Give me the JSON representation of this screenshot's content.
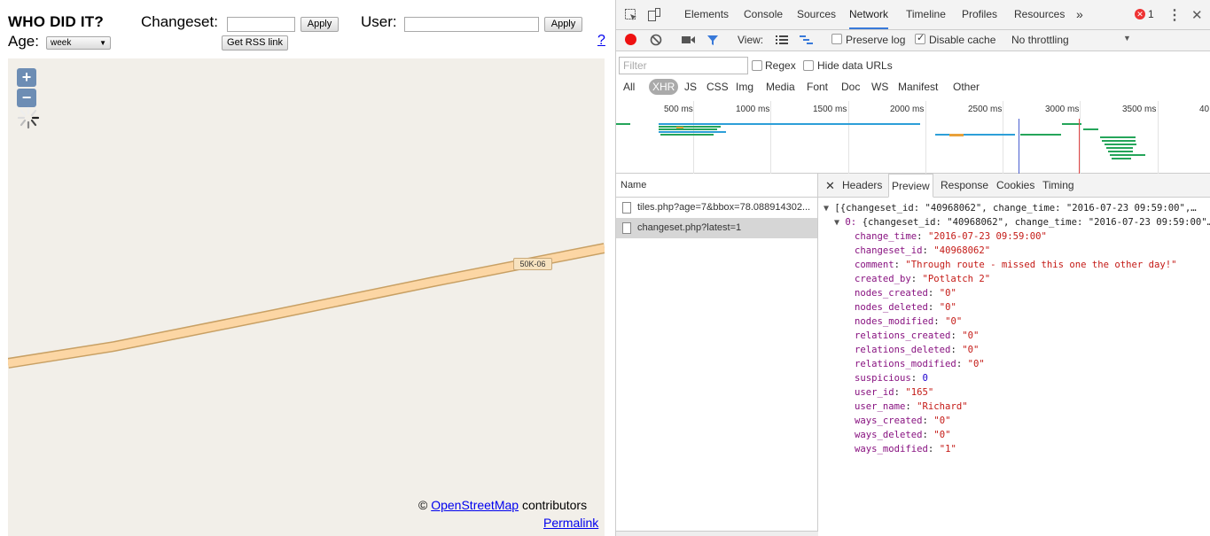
{
  "app": {
    "title": "WHO DID IT?",
    "changeset_label": "Changeset:",
    "apply_label": "Apply",
    "user_label": "User:",
    "age_label": "Age:",
    "age_value": "week",
    "rss_label": "Get RSS link",
    "help": "?"
  },
  "map": {
    "zoom_in": "+",
    "zoom_out": "−",
    "road_ref": "50K-06",
    "attrib_prefix": "©",
    "attrib_link": "OpenStreetMap",
    "attrib_suffix": "contributors",
    "permalink": "Permalink"
  },
  "devtools": {
    "tabs": [
      "Elements",
      "Console",
      "Sources",
      "Network",
      "Timeline",
      "Profiles",
      "Resources"
    ],
    "more": "»",
    "error_count": "1",
    "view_label": "View:",
    "preserve_log": "Preserve log",
    "disable_cache": "Disable cache",
    "throttling": "No throttling",
    "filter_placeholder": "Filter",
    "regex": "Regex",
    "hide_data_urls": "Hide data URLs",
    "types": [
      "All",
      "XHR",
      "JS",
      "CSS",
      "Img",
      "Media",
      "Font",
      "Doc",
      "WS",
      "Manifest",
      "Other"
    ],
    "timeline_labels": [
      "500 ms",
      "1000 ms",
      "1500 ms",
      "2000 ms",
      "2500 ms",
      "3000 ms",
      "3500 ms",
      "40"
    ],
    "name_header": "Name",
    "requests": [
      "tiles.php?age=7&bbox=78.088914302...",
      "changeset.php?latest=1"
    ],
    "detail_tabs": [
      "Headers",
      "Preview",
      "Response",
      "Cookies",
      "Timing"
    ],
    "preview_root": "[{changeset_id: \"40968062\", change_time: \"2016-07-23 09:59:00\",…",
    "preview_item_index": "0:",
    "preview_item": "{changeset_id: \"40968062\", change_time: \"2016-07-23 09:59:00\"…",
    "fields": [
      {
        "key": "change_time",
        "value": "\"2016-07-23 09:59:00\"",
        "type": "s"
      },
      {
        "key": "changeset_id",
        "value": "\"40968062\"",
        "type": "s"
      },
      {
        "key": "comment",
        "value": "\"Through route - missed this one the other day!\"",
        "type": "s"
      },
      {
        "key": "created_by",
        "value": "\"Potlatch 2\"",
        "type": "s"
      },
      {
        "key": "nodes_created",
        "value": "\"0\"",
        "type": "s"
      },
      {
        "key": "nodes_deleted",
        "value": "\"0\"",
        "type": "s"
      },
      {
        "key": "nodes_modified",
        "value": "\"0\"",
        "type": "s"
      },
      {
        "key": "relations_created",
        "value": "\"0\"",
        "type": "s"
      },
      {
        "key": "relations_deleted",
        "value": "\"0\"",
        "type": "s"
      },
      {
        "key": "relations_modified",
        "value": "\"0\"",
        "type": "s"
      },
      {
        "key": "suspicious",
        "value": "0",
        "type": "n"
      },
      {
        "key": "user_id",
        "value": "\"165\"",
        "type": "s"
      },
      {
        "key": "user_name",
        "value": "\"Richard\"",
        "type": "s"
      },
      {
        "key": "ways_created",
        "value": "\"0\"",
        "type": "s"
      },
      {
        "key": "ways_deleted",
        "value": "\"0\"",
        "type": "s"
      },
      {
        "key": "ways_modified",
        "value": "\"1\"",
        "type": "s"
      }
    ]
  }
}
